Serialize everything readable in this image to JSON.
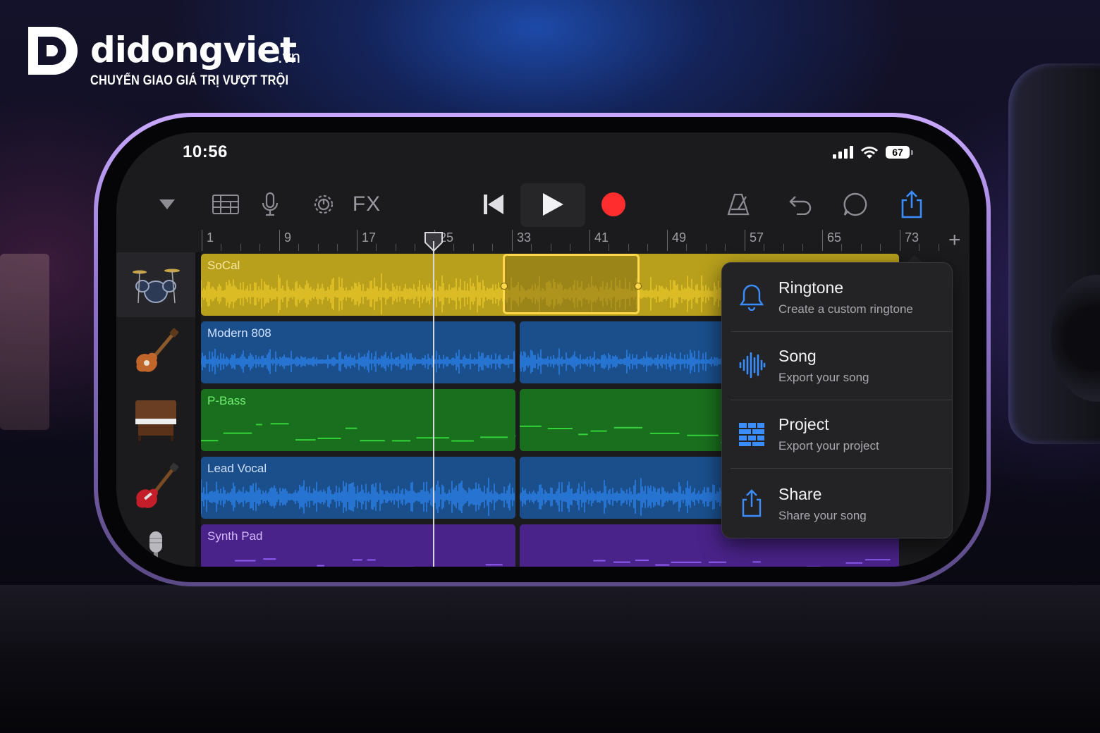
{
  "brand": {
    "name": "didongviet",
    "tld": ".vn",
    "slogan": "CHUYỂN GIAO GIÁ TRỊ VƯỢT TRỘI"
  },
  "status_bar": {
    "time": "10:56",
    "battery": "67"
  },
  "toolbar": {
    "fx_label": "FX",
    "icons": [
      "track-list-toggle-icon",
      "tracks-view-icon",
      "microphone-icon",
      "smart-controls-icon",
      "go-to-beginning-icon",
      "play-icon",
      "record-icon",
      "metronome-icon",
      "undo-icon",
      "loop-browser-icon",
      "share-icon"
    ],
    "record_color": "#ff2d2d",
    "share_active_color": "#3a8dff"
  },
  "ruler": {
    "bars": [
      "1",
      "9",
      "17",
      "25",
      "33",
      "41",
      "49",
      "57",
      "65",
      "73"
    ],
    "add_label": "+"
  },
  "tracks": [
    {
      "instrument": "drums-icon",
      "name": "SoCal",
      "color": "#b8a01c",
      "wave": "#f3cf2c",
      "text": "#f7e7a0"
    },
    {
      "instrument": "bass-guitar-icon",
      "name": "Modern 808",
      "color": "#1a4f8c",
      "wave": "#2f8cff",
      "text": "#cfe0ff"
    },
    {
      "instrument": "piano-icon",
      "name": "P-Bass",
      "color": "#1a6f1e",
      "wave": "#34d33a",
      "text": "#6ff06f"
    },
    {
      "instrument": "electric-guitar-icon",
      "name": "Lead Vocal",
      "color": "#1a4f8c",
      "wave": "#2f8cff",
      "text": "#cfe0ff"
    },
    {
      "instrument": "microphone-stand-icon",
      "name": "Synth Pad",
      "color": "#4a238a",
      "wave": "#8e5cf0",
      "text": "#d2b8ff"
    }
  ],
  "share_menu": {
    "items": [
      {
        "title": "Ringtone",
        "subtitle": "Create a custom ringtone",
        "icon": "bell-icon"
      },
      {
        "title": "Song",
        "subtitle": "Export your song",
        "icon": "waveform-icon"
      },
      {
        "title": "Project",
        "subtitle": "Export your project",
        "icon": "project-grid-icon"
      },
      {
        "title": "Share",
        "subtitle": "Share your song",
        "icon": "share-icon"
      }
    ],
    "accent": "#3a8dff"
  }
}
